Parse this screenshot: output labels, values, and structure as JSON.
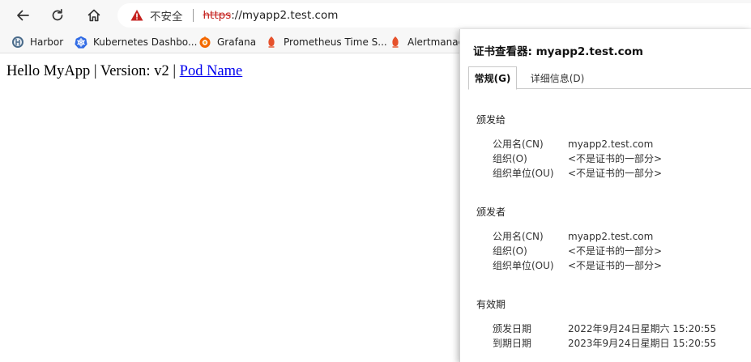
{
  "browser": {
    "security_label": "不安全",
    "url_scheme": "https",
    "url_rest": "://myapp2.test.com"
  },
  "bookmarks": [
    {
      "label": "Harbor",
      "icon": "harbor-icon"
    },
    {
      "label": "Kubernetes Dashbo...",
      "icon": "kubernetes-icon"
    },
    {
      "label": "Grafana",
      "icon": "grafana-icon"
    },
    {
      "label": "Prometheus Time S...",
      "icon": "prometheus-icon"
    },
    {
      "label": "Alertmanage",
      "icon": "prometheus-icon"
    }
  ],
  "page": {
    "text": "Hello MyApp | Version: v2 | ",
    "link": "Pod Name"
  },
  "cert": {
    "title": "证书查看器: myapp2.test.com",
    "tabs": [
      "常规(G)",
      "详细信息(D)"
    ],
    "issued_to": {
      "heading": "颁发给",
      "rows": [
        {
          "k": "公用名(CN)",
          "v": "myapp2.test.com"
        },
        {
          "k": "组织(O)",
          "v": "<不是证书的一部分>"
        },
        {
          "k": "组织单位(OU)",
          "v": "<不是证书的一部分>"
        }
      ]
    },
    "issued_by": {
      "heading": "颁发者",
      "rows": [
        {
          "k": "公用名(CN)",
          "v": "myapp2.test.com"
        },
        {
          "k": "组织(O)",
          "v": "<不是证书的一部分>"
        },
        {
          "k": "组织单位(OU)",
          "v": "<不是证书的一部分>"
        }
      ]
    },
    "validity": {
      "heading": "有效期",
      "rows": [
        {
          "k": "颁发日期",
          "v": "2022年9月24日星期六 15:20:55"
        },
        {
          "k": "到期日期",
          "v": "2023年9月24日星期日 15:20:55"
        }
      ]
    }
  },
  "colors": {
    "warning": "#c5221f",
    "link": "#0000ee"
  }
}
